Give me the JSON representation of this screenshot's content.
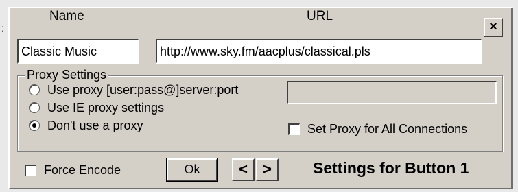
{
  "window": {
    "edge_char": ":"
  },
  "labels": {
    "name": "Name",
    "url": "URL"
  },
  "fields": {
    "name_value": "Classic Music",
    "url_value": "http://www.sky.fm/aacplus/classical.pls",
    "proxy_value": ""
  },
  "close_label": "×",
  "proxy": {
    "group_title": "Proxy Settings",
    "options": [
      {
        "label": "Use proxy [user:pass@]server:port",
        "selected": false
      },
      {
        "label": "Use IE proxy settings",
        "selected": false
      },
      {
        "label": "Don't use a proxy",
        "selected": true
      }
    ],
    "set_all_label": "Set  Proxy for All Connections",
    "set_all_checked": false
  },
  "force_encode": {
    "label": "Force Encode",
    "checked": false
  },
  "buttons": {
    "ok": "Ok",
    "prev": "<",
    "next": ">"
  },
  "status": "Settings for Button 1",
  "colors": {
    "dialog_face": "#d4d0c8",
    "background": "#e9e9e9",
    "field_bg": "#ffffff",
    "text": "#000000"
  }
}
